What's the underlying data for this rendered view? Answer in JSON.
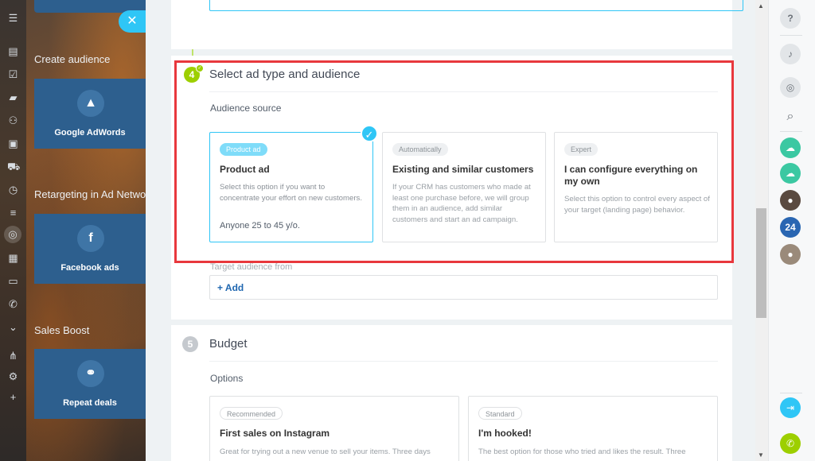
{
  "left_panel": {
    "sections": [
      {
        "title": "Create audience",
        "tile": {
          "label": "Google AdWords",
          "icon": "adwords-icon"
        }
      },
      {
        "title": "Retargeting in Ad Netwo",
        "tile": {
          "label": "Facebook ads",
          "icon": "facebook-icon"
        }
      },
      {
        "title": "Sales Boost",
        "tile": {
          "label": "Repeat deals",
          "icon": "handshake-icon"
        }
      }
    ],
    "close_label": "✕"
  },
  "step4": {
    "number": "4",
    "title": "Select ad type and audience",
    "audience_source_label": "Audience source",
    "options": [
      {
        "tag": "Product ad",
        "title": "Product ad",
        "text": "Select this option if you want to concentrate your effort on new customers.",
        "footer": "Anyone 25 to 45 y/o.",
        "selected": true
      },
      {
        "tag": "Automatically",
        "title": "Existing and similar customers",
        "text": "If your CRM has customers who made at least one purchase before, we will group them in an audience, add similar customers and start an ad campaign.",
        "selected": false
      },
      {
        "tag": "Expert",
        "title": "I can configure everything on my own",
        "text": "Select this option to control every aspect of your target (landing page) behavior.",
        "selected": false
      }
    ],
    "target_label": "Target audience from",
    "add_label": "+ Add"
  },
  "step5": {
    "number": "5",
    "title": "Budget",
    "options_label": "Options",
    "options": [
      {
        "tag": "Recommended",
        "title": "First sales on Instagram",
        "text": "Great for trying out a new venue to sell your items. Three days"
      },
      {
        "tag": "Standard",
        "title": "I'm hooked!",
        "text": "The best option for those who tried and likes the result. Three"
      }
    ]
  },
  "right_rail": {
    "counter": "24"
  },
  "colors": {
    "accent": "#2fc6f6",
    "step_active": "#9dcf00",
    "highlight": "#e8383d",
    "tile": "#2d5f8e"
  }
}
